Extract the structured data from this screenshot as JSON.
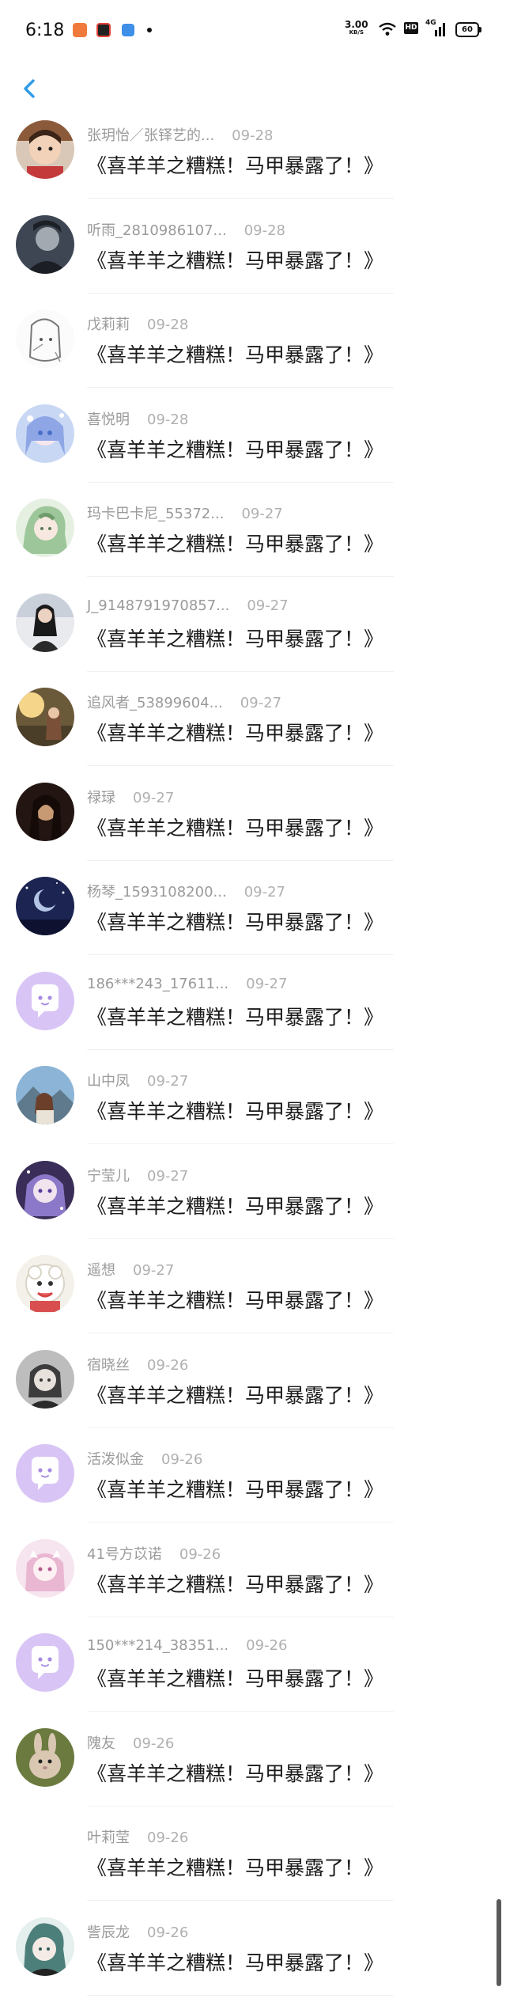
{
  "status_bar": {
    "time": "6:18",
    "net_speed_value": "3.00",
    "net_speed_unit": "KB/S",
    "hd_badge": "HD",
    "signal_label": "4G",
    "battery": "60"
  },
  "nav": {
    "back_icon": "chevron-left-icon",
    "accent": "#2f9be6"
  },
  "messages": [
    {
      "name": "张玥怡／张铎艺的...",
      "date": "09-28",
      "text": "《喜羊羊之糟糕！马甲暴露了！》",
      "avatar": "photo-child"
    },
    {
      "name": "听雨_2810986107...",
      "date": "09-28",
      "text": "《喜羊羊之糟糕！马甲暴露了！》",
      "avatar": "photo-dark-figure"
    },
    {
      "name": "戊莉莉",
      "date": "09-28",
      "text": "《喜羊羊之糟糕！马甲暴露了！》",
      "avatar": "anime-sketch"
    },
    {
      "name": "喜悦明",
      "date": "09-28",
      "text": "《喜羊羊之糟糕！马甲暴露了！》",
      "avatar": "anime-blue"
    },
    {
      "name": "玛卡巴卡尼_55372...",
      "date": "09-27",
      "text": "《喜羊羊之糟糕！马甲暴露了！》",
      "avatar": "anime-green"
    },
    {
      "name": "J_9148791970857...",
      "date": "09-27",
      "text": "《喜羊羊之糟糕！马甲暴露了！》",
      "avatar": "photo-girl"
    },
    {
      "name": "追风者_53899604...",
      "date": "09-27",
      "text": "《喜羊羊之糟糕！马甲暴露了！》",
      "avatar": "photo-sunset"
    },
    {
      "name": "禄琭",
      "date": "09-27",
      "text": "《喜羊羊之糟糕！马甲暴露了！》",
      "avatar": "photo-dark"
    },
    {
      "name": "杨琴_1593108200...",
      "date": "09-27",
      "text": "《喜羊羊之糟糕！马甲暴露了！》",
      "avatar": "photo-night"
    },
    {
      "name": "186***243_17611...",
      "date": "09-27",
      "text": "《喜羊羊之糟糕！马甲暴露了！》",
      "avatar": "default-bubble"
    },
    {
      "name": "山中凤",
      "date": "09-27",
      "text": "《喜羊羊之糟糕！马甲暴露了！》",
      "avatar": "photo-mountain"
    },
    {
      "name": "宁莹儿",
      "date": "09-27",
      "text": "《喜羊羊之糟糕！马甲暴露了！》",
      "avatar": "anime-purple"
    },
    {
      "name": "遥想",
      "date": "09-27",
      "text": "《喜羊羊之糟糕！马甲暴露了！》",
      "avatar": "cartoon-sheep"
    },
    {
      "name": "宿晓丝",
      "date": "09-26",
      "text": "《喜羊羊之糟糕！马甲暴露了！》",
      "avatar": "anime-gray"
    },
    {
      "name": "活泼似金",
      "date": "09-26",
      "text": "《喜羊羊之糟糕！马甲暴露了！》",
      "avatar": "default-bubble"
    },
    {
      "name": "41号方苡诺",
      "date": "09-26",
      "text": "《喜羊羊之糟糕！马甲暴露了！》",
      "avatar": "anime-pink"
    },
    {
      "name": "150***214_38351...",
      "date": "09-26",
      "text": "《喜羊羊之糟糕！马甲暴露了！》",
      "avatar": "default-bubble"
    },
    {
      "name": "隗友",
      "date": "09-26",
      "text": "《喜羊羊之糟糕！马甲暴露了！》",
      "avatar": "photo-bunny"
    },
    {
      "name": "叶莉莹",
      "date": "09-26",
      "text": "《喜羊羊之糟糕！马甲暴露了！》",
      "avatar": "none"
    },
    {
      "name": "訾辰龙",
      "date": "09-26",
      "text": "《喜羊羊之糟糕！马甲暴露了！》",
      "avatar": "anime-teal"
    }
  ]
}
